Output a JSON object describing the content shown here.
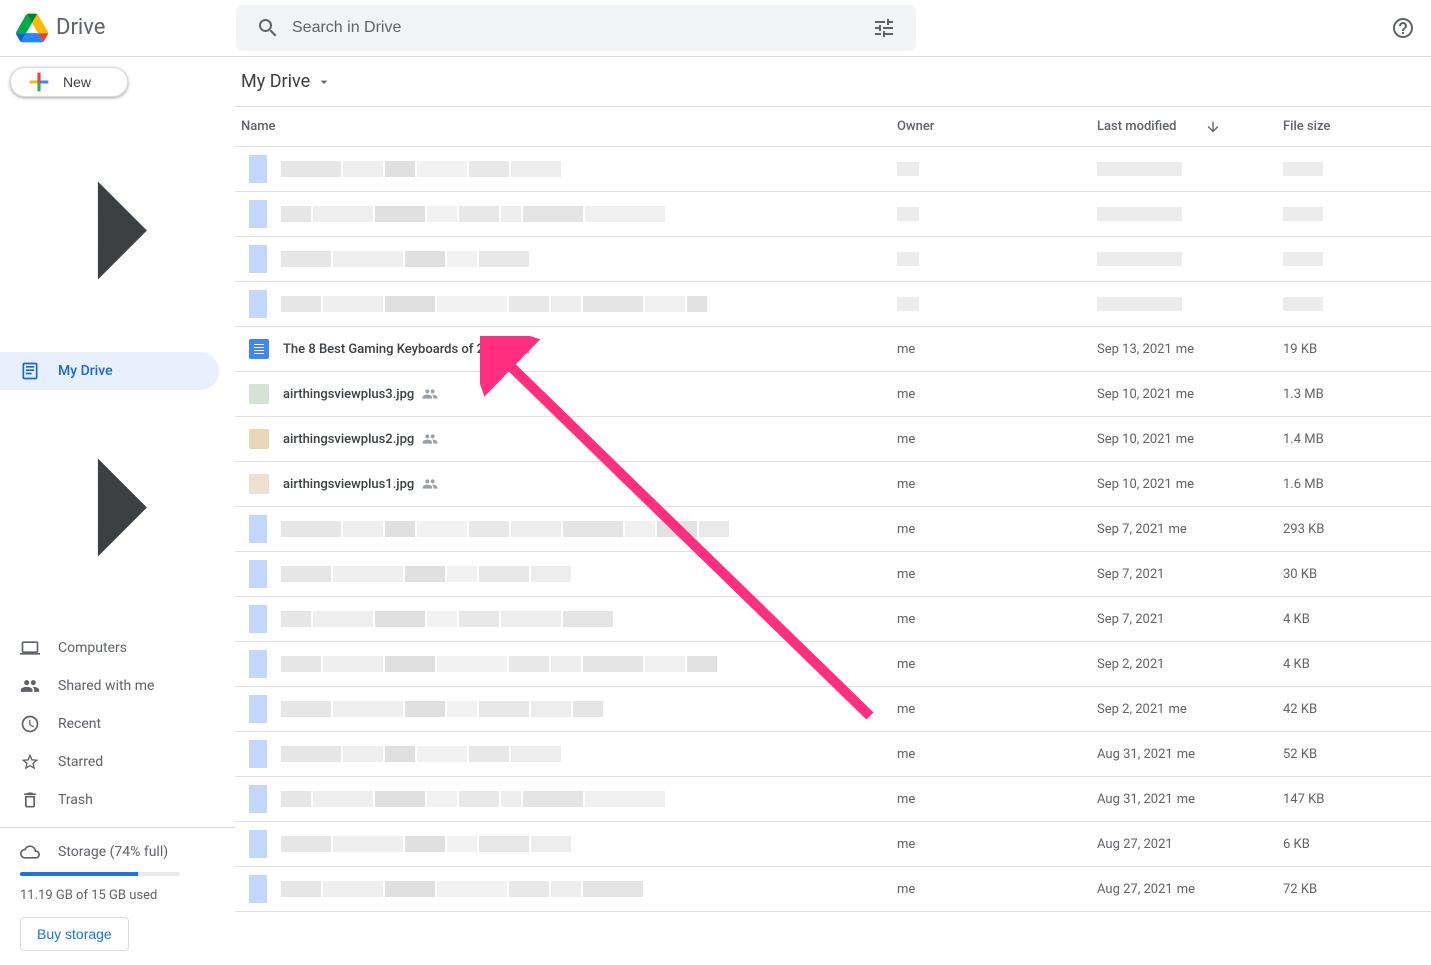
{
  "app": {
    "name": "Drive"
  },
  "search": {
    "placeholder": "Search in Drive"
  },
  "newButton": {
    "label": "New"
  },
  "sidebar": {
    "items": [
      {
        "label": "My Drive",
        "icon": "my-drive",
        "active": true,
        "expandable": true
      },
      {
        "label": "Computers",
        "icon": "computers",
        "active": false,
        "expandable": true
      },
      {
        "label": "Shared with me",
        "icon": "shared",
        "active": false,
        "expandable": false
      },
      {
        "label": "Recent",
        "icon": "recent",
        "active": false,
        "expandable": false
      },
      {
        "label": "Starred",
        "icon": "starred",
        "active": false,
        "expandable": false
      },
      {
        "label": "Trash",
        "icon": "trash",
        "active": false,
        "expandable": false
      }
    ]
  },
  "storage": {
    "label": "Storage (74% full)",
    "percent": 74,
    "usage": "11.19 GB of 15 GB used",
    "buy": "Buy storage"
  },
  "breadcrumb": {
    "label": "My Drive"
  },
  "columns": {
    "name": "Name",
    "owner": "Owner",
    "modified": "Last modified",
    "size": "File size"
  },
  "files": [
    {
      "redacted": true,
      "nameWidths": [
        60,
        40,
        30,
        50,
        40,
        50
      ],
      "owner": "",
      "modified": "",
      "modifiedBy": "",
      "size": "",
      "shared": false
    },
    {
      "redacted": true,
      "nameWidths": [
        30,
        60,
        50,
        30,
        40,
        20,
        60,
        80
      ],
      "owner": "",
      "modified": "",
      "modifiedBy": "",
      "size": "",
      "shared": false
    },
    {
      "redacted": true,
      "nameWidths": [
        50,
        70,
        40,
        30,
        50
      ],
      "owner": "",
      "modified": "",
      "modifiedBy": "",
      "size": "",
      "shared": false
    },
    {
      "redacted": true,
      "nameWidths": [
        40,
        60,
        50,
        70,
        40,
        30,
        60,
        40,
        20
      ],
      "owner": "",
      "modified": "",
      "modifiedBy": "",
      "size": "",
      "shared": false
    },
    {
      "redacted": false,
      "icon": "doc",
      "name": "The 8 Best Gaming Keyboards of 2021",
      "owner": "me",
      "modified": "Sep 13, 2021",
      "modifiedBy": "me",
      "size": "19 KB",
      "shared": true
    },
    {
      "redacted": false,
      "icon": "img1",
      "name": "airthingsviewplus3.jpg",
      "owner": "me",
      "modified": "Sep 10, 2021",
      "modifiedBy": "me",
      "size": "1.3 MB",
      "shared": true
    },
    {
      "redacted": false,
      "icon": "img2",
      "name": "airthingsviewplus2.jpg",
      "owner": "me",
      "modified": "Sep 10, 2021",
      "modifiedBy": "me",
      "size": "1.4 MB",
      "shared": true
    },
    {
      "redacted": false,
      "icon": "img3",
      "name": "airthingsviewplus1.jpg",
      "owner": "me",
      "modified": "Sep 10, 2021",
      "modifiedBy": "me",
      "size": "1.6 MB",
      "shared": true
    },
    {
      "redacted": true,
      "nameWidths": [
        60,
        40,
        30,
        50,
        40,
        50,
        60,
        30,
        40,
        30
      ],
      "owner": "me",
      "modified": "Sep 7, 2021",
      "modifiedBy": "me",
      "size": "293 KB",
      "shared": false
    },
    {
      "redacted": true,
      "nameWidths": [
        50,
        70,
        40,
        30,
        50,
        40
      ],
      "owner": "me",
      "modified": "Sep 7, 2021",
      "modifiedBy": "",
      "size": "30 KB",
      "shared": false
    },
    {
      "redacted": true,
      "nameWidths": [
        30,
        60,
        50,
        30,
        40,
        60,
        50
      ],
      "owner": "me",
      "modified": "Sep 7, 2021",
      "modifiedBy": "",
      "size": "4 KB",
      "shared": false
    },
    {
      "redacted": true,
      "nameWidths": [
        40,
        60,
        50,
        70,
        40,
        30,
        60,
        40,
        30
      ],
      "owner": "me",
      "modified": "Sep 2, 2021",
      "modifiedBy": "",
      "size": "4 KB",
      "shared": false
    },
    {
      "redacted": true,
      "nameWidths": [
        50,
        70,
        40,
        30,
        50,
        40,
        30
      ],
      "owner": "me",
      "modified": "Sep 2, 2021",
      "modifiedBy": "me",
      "size": "42 KB",
      "shared": false
    },
    {
      "redacted": true,
      "nameWidths": [
        60,
        40,
        30,
        50,
        40,
        50
      ],
      "owner": "me",
      "modified": "Aug 31, 2021",
      "modifiedBy": "me",
      "size": "52 KB",
      "shared": false
    },
    {
      "redacted": true,
      "nameWidths": [
        30,
        60,
        50,
        30,
        40,
        20,
        60,
        80
      ],
      "owner": "me",
      "modified": "Aug 31, 2021",
      "modifiedBy": "me",
      "size": "147 KB",
      "shared": false
    },
    {
      "redacted": true,
      "nameWidths": [
        50,
        70,
        40,
        30,
        50,
        40
      ],
      "owner": "me",
      "modified": "Aug 27, 2021",
      "modifiedBy": "",
      "size": "6 KB",
      "shared": false
    },
    {
      "redacted": true,
      "nameWidths": [
        40,
        60,
        50,
        70,
        40,
        30,
        60
      ],
      "owner": "me",
      "modified": "Aug 27, 2021",
      "modifiedBy": "me",
      "size": "72 KB",
      "shared": false
    }
  ]
}
